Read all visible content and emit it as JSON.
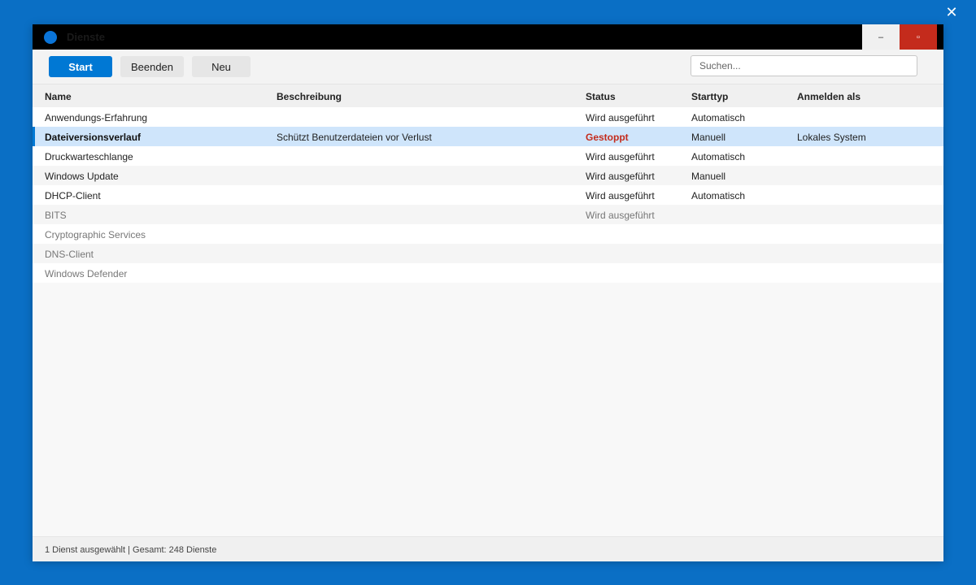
{
  "window": {
    "title": "Dienste",
    "minimize_glyph": "–",
    "maximize_glyph": "▫",
    "close_glyph": "✕"
  },
  "toolbar": {
    "start_label": "Start",
    "stop_label": "Beenden",
    "new_label": "Neu",
    "search_placeholder": "Suchen..."
  },
  "table": {
    "columns": {
      "name": "Name",
      "description": "Beschreibung",
      "status": "Status",
      "startup_type": "Starttyp",
      "logon_as": "Anmelden als"
    },
    "rows": [
      {
        "name": "Anwendungs-Erfahrung",
        "description": "",
        "status": "Wird ausgeführt",
        "startup_type": "Automatisch",
        "logon_as": ""
      },
      {
        "name": "Dateiversionsverlauf",
        "description": "Schützt Benutzerdateien vor Verlust",
        "status": "Gestoppt",
        "startup_type": "Manuell",
        "logon_as": "Lokales System"
      },
      {
        "name": "Druckwarteschlange",
        "description": "",
        "status": "Wird ausgeführt",
        "startup_type": "Automatisch",
        "logon_as": ""
      },
      {
        "name": "Windows Update",
        "description": "",
        "status": "Wird ausgeführt",
        "startup_type": "Manuell",
        "logon_as": ""
      },
      {
        "name": "DHCP-Client",
        "description": "",
        "status": "Wird ausgeführt",
        "startup_type": "Automatisch",
        "logon_as": ""
      },
      {
        "name": "BITS",
        "description": "",
        "status": "Wird ausgeführt",
        "startup_type": "",
        "logon_as": ""
      },
      {
        "name": "Cryptographic Services",
        "description": "",
        "status": "",
        "startup_type": "",
        "logon_as": ""
      },
      {
        "name": "DNS-Client",
        "description": "",
        "status": "",
        "startup_type": "",
        "logon_as": ""
      },
      {
        "name": "Windows Defender",
        "description": "",
        "status": "",
        "startup_type": "",
        "logon_as": ""
      }
    ]
  },
  "statusbar": {
    "text": "1 Dienst ausgewählt | Gesamt: 248 Dienste"
  },
  "colors": {
    "accent": "#0078d4",
    "stopped": "#c42b1c",
    "selection": "#cfe5fb",
    "desktop": "#0a6fc5"
  }
}
